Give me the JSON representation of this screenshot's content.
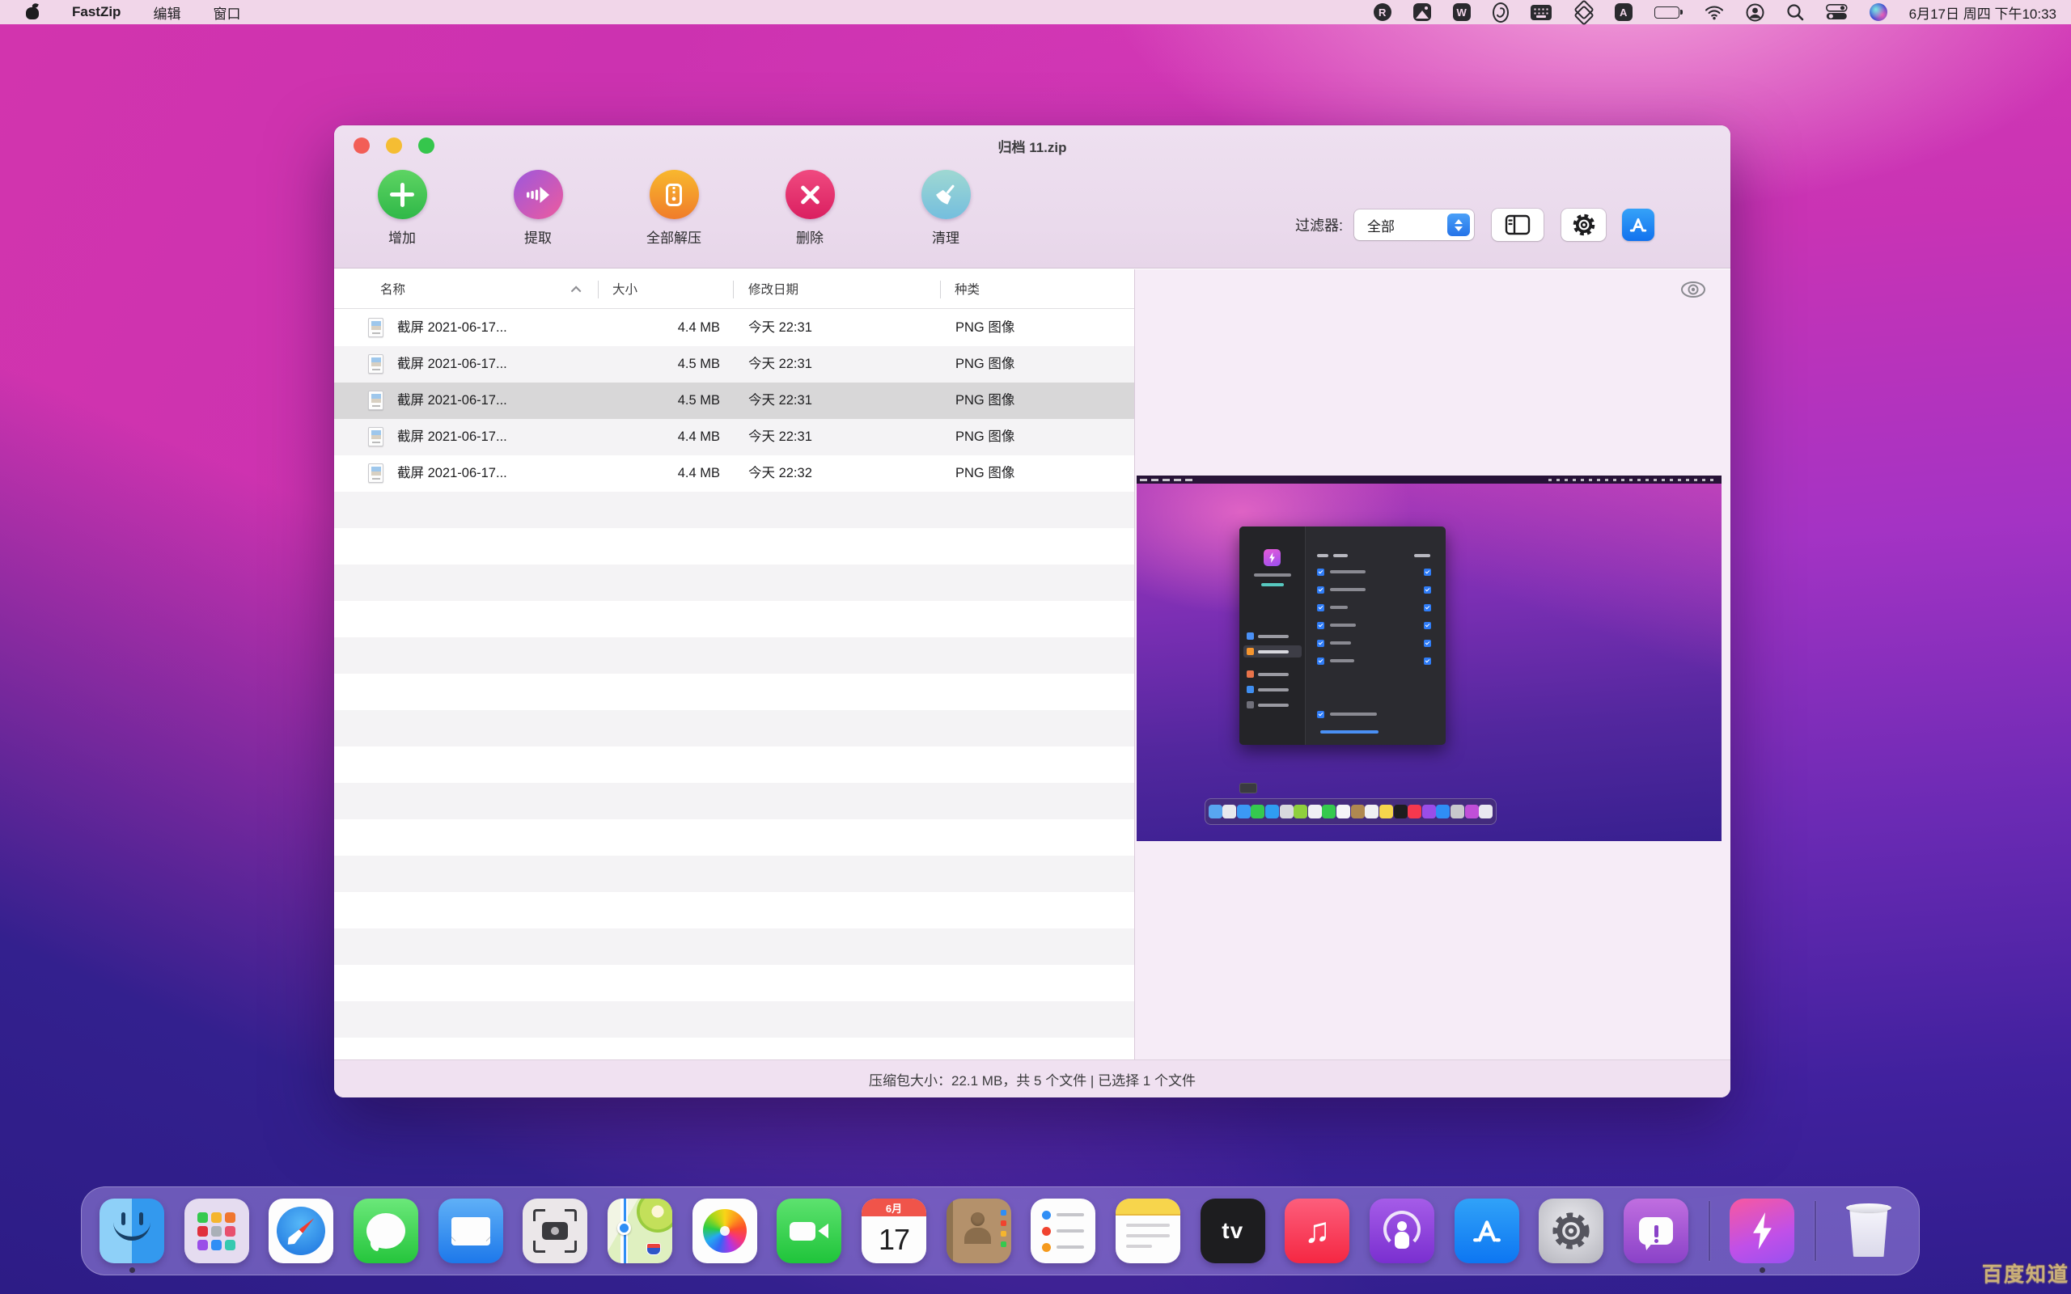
{
  "menu_bar": {
    "app_name": "FastZip",
    "menus": [
      "编辑",
      "窗口"
    ],
    "status_icons": [
      "r-badge-icon",
      "screenshot-app-icon",
      "w-app-icon",
      "shell-app-icon",
      "keyboard-icon",
      "layers-icon",
      "input-method-a-icon",
      "battery-icon",
      "wifi-icon",
      "user-icon",
      "search-icon",
      "control-center-icon",
      "siri-icon"
    ],
    "clock": "6月17日 周四 下午10:33"
  },
  "window": {
    "title": "归档 11.zip",
    "toolbar": {
      "buttons": [
        {
          "label": "增加",
          "icon": "plus-circle",
          "color": "#3fc455"
        },
        {
          "label": "提取",
          "icon": "arrow-right-circle",
          "color": "#c457b9"
        },
        {
          "label": "全部解压",
          "icon": "archive-box-circle",
          "color": "#f59a2c"
        },
        {
          "label": "删除",
          "icon": "x-circle",
          "color": "#e63470"
        },
        {
          "label": "清理",
          "icon": "broom-circle",
          "color": "#8acbd8"
        }
      ],
      "filter_label": "过滤器:",
      "filter_value": "全部"
    },
    "table": {
      "headers": {
        "name": "名称",
        "size": "大小",
        "date": "修改日期",
        "kind": "种类"
      },
      "rows": [
        {
          "name": "截屏 2021-06-17...",
          "size": "4.4 MB",
          "date": "今天 22:31",
          "kind": "PNG 图像",
          "selected": false
        },
        {
          "name": "截屏 2021-06-17...",
          "size": "4.5 MB",
          "date": "今天 22:31",
          "kind": "PNG 图像",
          "selected": false
        },
        {
          "name": "截屏 2021-06-17...",
          "size": "4.5 MB",
          "date": "今天 22:31",
          "kind": "PNG 图像",
          "selected": true
        },
        {
          "name": "截屏 2021-06-17...",
          "size": "4.4 MB",
          "date": "今天 22:31",
          "kind": "PNG 图像",
          "selected": false
        },
        {
          "name": "截屏 2021-06-17...",
          "size": "4.4 MB",
          "date": "今天 22:32",
          "kind": "PNG 图像",
          "selected": false
        }
      ]
    },
    "status_bar": "压缩包大小：22.1 MB，共 5 个文件 | 已选择 1 个文件"
  },
  "dock": {
    "items": [
      "finder",
      "launchpad",
      "safari",
      "messages",
      "mail",
      "screenshot",
      "maps",
      "photos",
      "facetime",
      "calendar",
      "contacts",
      "reminders",
      "notes",
      "apple-tv",
      "music",
      "podcasts",
      "app-store",
      "system-preferences",
      "feedback-assistant",
      "fastzip",
      "trash"
    ],
    "calendar": {
      "month": "6月",
      "day": "17"
    },
    "appletv_label": "tv"
  },
  "watermark": "百度知道",
  "colors": {
    "accent_blue": "#2f7cf6",
    "menu_bar_bg": "#f1d6e9",
    "selected_row": "#d8d7d8",
    "preview_bg": "#f6ecf7",
    "dock_bg": "rgba(151,133,219,0.58)"
  }
}
